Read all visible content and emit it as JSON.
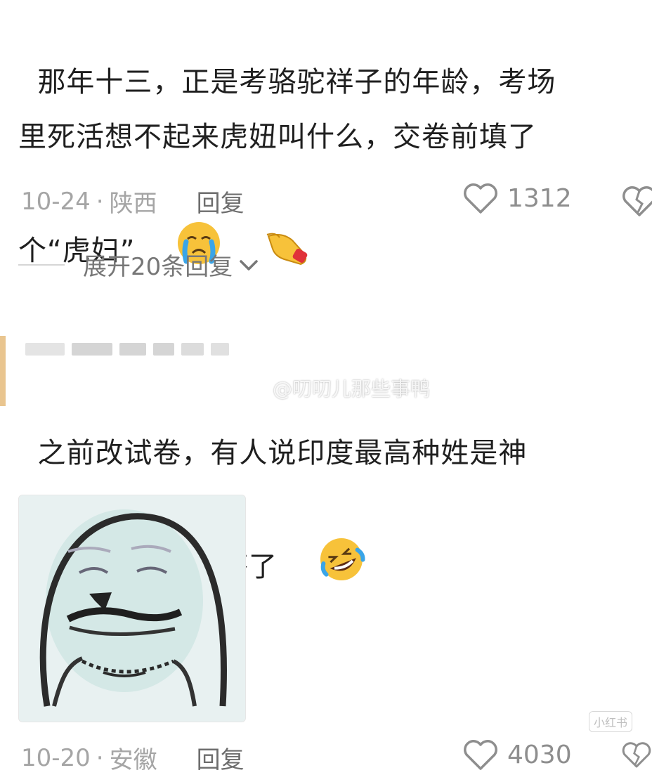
{
  "comments": [
    {
      "text": "那年十三，正是考骆驼祥子的年龄，考场\n里死活想不起来虎妞叫什么，交卷前填了\n个“虎妇”",
      "date": "10-24",
      "separator": "·",
      "location": "陕西",
      "reply_label": "回复",
      "likes": "1312",
      "emojis": [
        "crying-face-emoji",
        "pointing-hand-emoji"
      ],
      "expand_label": "展开20条回复"
    },
    {
      "text": "之前改试卷，有人说印度最高种姓是神\n婆，给我笑成大芬了",
      "date": "10-20",
      "separator": "·",
      "location": "安徽",
      "reply_label": "回复",
      "likes": "4030",
      "emojis": [
        "rolling-laughing-emoji"
      ],
      "sticker": "sketch-face-sticker"
    }
  ],
  "watermark": "@叨叨儿那些事鸭",
  "corner_logo": "小红书",
  "colors": {
    "text": "#1f1f1f",
    "meta": "#a5a5a5",
    "reply": "#6d6d6d",
    "emoji_yellow": "#f7c23a",
    "tear_blue": "#3aa5e8"
  }
}
